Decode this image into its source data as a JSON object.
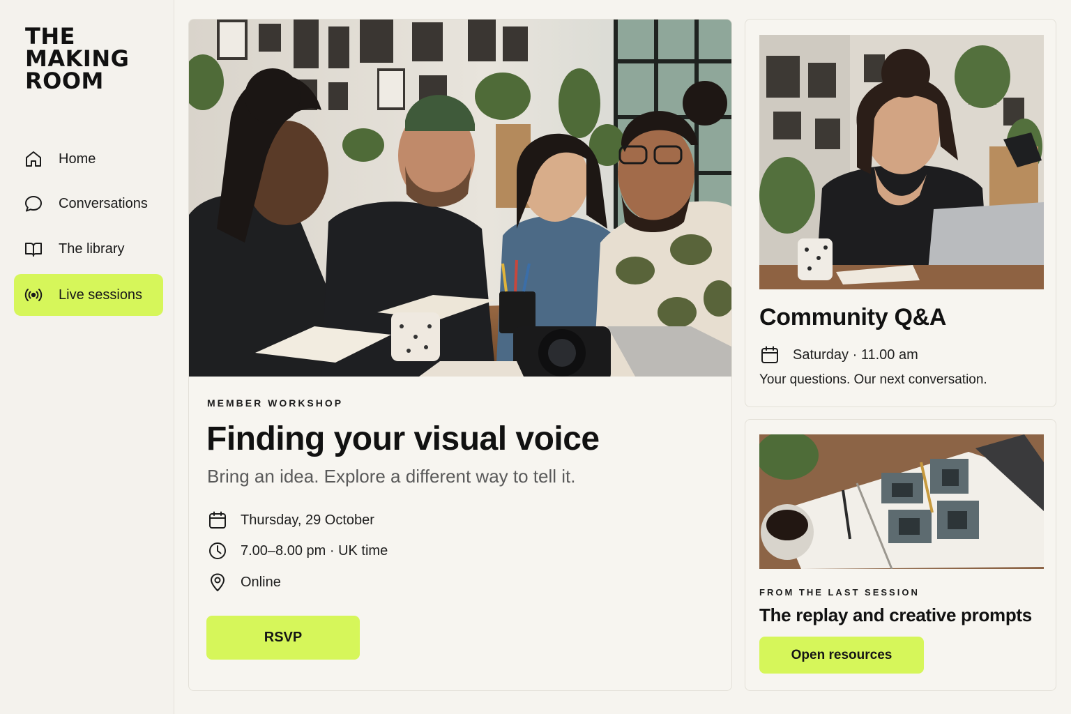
{
  "brand": {
    "lines": [
      "THE",
      "MAKING",
      "ROOM"
    ]
  },
  "sidebar": {
    "items": [
      {
        "label": "Home",
        "icon": "home-icon",
        "active": false
      },
      {
        "label": "Conversations",
        "icon": "chat-bubble-icon",
        "active": false
      },
      {
        "label": "The library",
        "icon": "book-icon",
        "active": false
      },
      {
        "label": "Live sessions",
        "icon": "broadcast-icon",
        "active": true
      }
    ]
  },
  "featured": {
    "eyebrow": "MEMBER WORKSHOP",
    "title": "Finding your visual voice",
    "subtitle": "Bring an idea. Explore a different way to tell it.",
    "details": [
      {
        "icon": "calendar-icon",
        "text": "Thursday, 29 October"
      },
      {
        "icon": "clock-icon",
        "text": "7.00–8.00 pm · UK time"
      },
      {
        "icon": "location-pin-icon",
        "text": "Online"
      }
    ],
    "cta": "RSVP"
  },
  "qa": {
    "title": "Community Q&A",
    "when": "Saturday  · 11.00 am",
    "when_icon": "calendar-icon",
    "description": "Your questions. Our next conversation."
  },
  "resources": {
    "eyebrow": "FROM THE LAST SESSION",
    "title": "The replay and creative prompts",
    "cta": "Open resources"
  },
  "colors": {
    "accent": "#d6f65a",
    "background": "#f6f4ef",
    "text": "#141414",
    "muted": "#5a5a5a"
  }
}
